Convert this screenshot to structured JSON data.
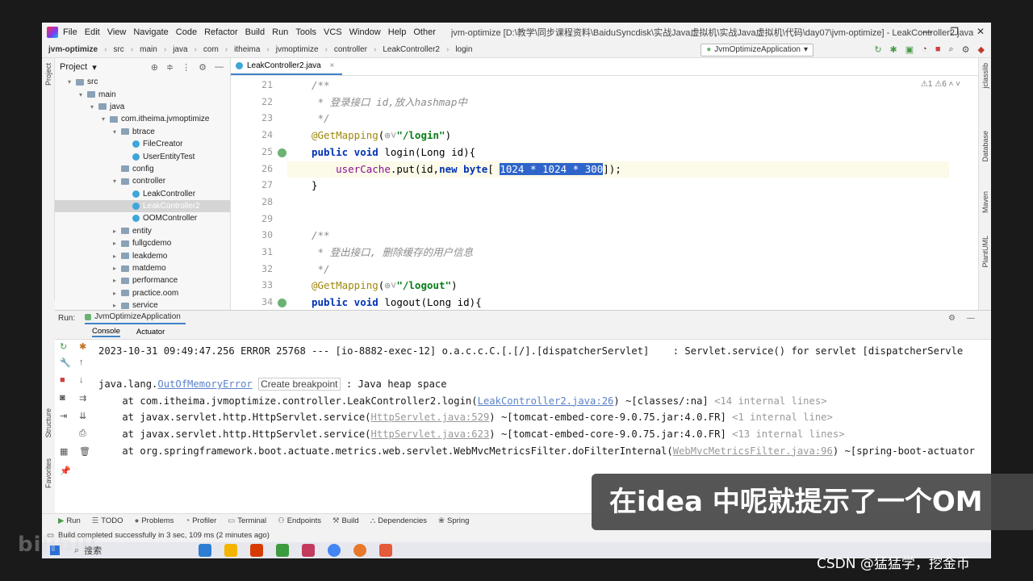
{
  "menubar": {
    "items": [
      "File",
      "Edit",
      "View",
      "Navigate",
      "Code",
      "Refactor",
      "Build",
      "Run",
      "Tools",
      "VCS",
      "Window",
      "Help",
      "Other"
    ],
    "window_title": "jvm-optimize [D:\\教学\\同步课程资料\\BaiduSyncdisk\\实战Java虚拟机\\实战Java虚拟机\\代码\\day07\\jvm-optimize] - LeakController2.java",
    "controls": [
      "—",
      "❐",
      "✕"
    ]
  },
  "breadcrumbs": [
    "jvm-optimize",
    "src",
    "main",
    "java",
    "com",
    "itheima",
    "jvmoptimize",
    "controller",
    "LeakController2",
    "login"
  ],
  "run_config": "JvmOptimizeApplication",
  "left_strip": {
    "project_label": "Project",
    "structure_label": "Structure",
    "favorites_label": "Favorites"
  },
  "right_strip": [
    "jclasslib",
    "Database",
    "Maven",
    "PlantUML"
  ],
  "project": {
    "title": "Project",
    "tree": [
      {
        "label": "src",
        "indent": 1,
        "type": "folder",
        "arrow": "▾"
      },
      {
        "label": "main",
        "indent": 2,
        "type": "folder",
        "arrow": "▾"
      },
      {
        "label": "java",
        "indent": 3,
        "type": "folder",
        "arrow": "▾"
      },
      {
        "label": "com.itheima.jvmoptimize",
        "indent": 4,
        "type": "folder",
        "arrow": "▾"
      },
      {
        "label": "btrace",
        "indent": 5,
        "type": "folder",
        "arrow": "▾"
      },
      {
        "label": "FileCreator",
        "indent": 6,
        "type": "class",
        "arrow": ""
      },
      {
        "label": "UserEntityTest",
        "indent": 6,
        "type": "class",
        "arrow": ""
      },
      {
        "label": "config",
        "indent": 5,
        "type": "folder",
        "arrow": ""
      },
      {
        "label": "controller",
        "indent": 5,
        "type": "folder",
        "arrow": "▾"
      },
      {
        "label": "LeakController",
        "indent": 6,
        "type": "class",
        "arrow": ""
      },
      {
        "label": "LeakController2",
        "indent": 6,
        "type": "class",
        "arrow": "",
        "selected": true
      },
      {
        "label": "OOMController",
        "indent": 6,
        "type": "class",
        "arrow": ""
      },
      {
        "label": "entity",
        "indent": 5,
        "type": "folder",
        "arrow": "▸"
      },
      {
        "label": "fullgcdemo",
        "indent": 5,
        "type": "folder",
        "arrow": "▸"
      },
      {
        "label": "leakdemo",
        "indent": 5,
        "type": "folder",
        "arrow": "▸"
      },
      {
        "label": "matdemo",
        "indent": 5,
        "type": "folder",
        "arrow": "▸"
      },
      {
        "label": "performance",
        "indent": 5,
        "type": "folder",
        "arrow": "▸"
      },
      {
        "label": "practice.oom",
        "indent": 5,
        "type": "folder",
        "arrow": "▸"
      },
      {
        "label": "service",
        "indent": 5,
        "type": "folder",
        "arrow": "▸"
      }
    ]
  },
  "editor": {
    "tab_label": "LeakController2.java",
    "warnings": "⚠1  ⚠6  ˄ ˅",
    "lines": [
      {
        "n": "21",
        "html": "<span class=\"cmt\">/**</span>"
      },
      {
        "n": "22",
        "html": "<span class=\"cmt\"> * 登录接口 id,放入hashmap中</span>"
      },
      {
        "n": "23",
        "html": "<span class=\"cmt\"> */</span>"
      },
      {
        "n": "24",
        "html": "<span class=\"ann\">@GetMapping</span>(<span class=\"gry\">⊕˅</span><span class=\"str\">\"/login\"</span>)"
      },
      {
        "n": "25",
        "html": "<span class=\"kw\">public void</span> login(Long id){",
        "icon": true
      },
      {
        "n": "26",
        "html": "    <span class=\"fld\">userCache</span>.put(id,<span class=\"kw\">new byte</span>[ <span class=\"sel\">1024 * 1024 * 300</span>]);",
        "highlight": true
      },
      {
        "n": "27",
        "html": "}"
      },
      {
        "n": "28",
        "html": ""
      },
      {
        "n": "29",
        "html": ""
      },
      {
        "n": "30",
        "html": "<span class=\"cmt\">/**</span>"
      },
      {
        "n": "31",
        "html": "<span class=\"cmt\"> * 登出接口, 删除缓存的用户信息</span>"
      },
      {
        "n": "32",
        "html": "<span class=\"cmt\"> */</span>"
      },
      {
        "n": "33",
        "html": "<span class=\"ann\">@GetMapping</span>(<span class=\"gry\">⊕˅</span><span class=\"str\">\"/logout\"</span>)"
      },
      {
        "n": "34",
        "html": "<span class=\"kw\">public void</span> logout(Long id){",
        "icon": true
      }
    ]
  },
  "run": {
    "label": "Run:",
    "tab": "JvmOptimizeApplication",
    "subtabs": [
      "Console",
      "Actuator"
    ],
    "console": [
      "2023-10-31 09:49:47.256 ERROR 25768 --- [io-8882-exec-12] o.a.c.c.C.[.[/].[dispatcherServlet]    : Servlet.service() for servlet [dispatcherServle",
      "",
      "java.lang.<span class=\"lnk\">OutOfMemoryError</span> <span class=\"box\">Create breakpoint</span> : Java heap space",
      "    at com.itheima.jvmoptimize.controller.LeakController2.login(<span class=\"lnk\">LeakController2.java:26</span>) ~[classes/:na] <span class=\"gry\">&lt;14 internal lines&gt;</span>",
      "    at javax.servlet.http.HttpServlet.service(<span class=\"lnk gry\">HttpServlet.java:529</span>) ~[tomcat-embed-core-9.0.75.jar:4.0.FR] <span class=\"gry\">&lt;1 internal line&gt;</span>",
      "    at javax.servlet.http.HttpServlet.service(<span class=\"lnk gry\">HttpServlet.java:623</span>) ~[tomcat-embed-core-9.0.75.jar:4.0.FR] <span class=\"gry\">&lt;13 internal lines&gt;</span>",
      "    at org.springframework.boot.actuate.metrics.web.servlet.WebMvcMetricsFilter.doFilterInternal(<span class=\"lnk gry\">WebMvcMetricsFilter.java:96</span>) ~[spring-boot-actuator"
    ]
  },
  "bottom_tabs": [
    "Run",
    "TODO",
    "Problems",
    "Profiler",
    "Terminal",
    "Endpoints",
    "Build",
    "Dependencies",
    "Spring"
  ],
  "status": "Build completed successfully in 3 sec, 109 ms (2 minutes ago)",
  "taskbar": {
    "search": "搜索"
  },
  "subtitle": "在idea 中呢就提示了一个OM",
  "watermark": "CSDN @猛猛学，挖金币",
  "bili": "bilibili"
}
